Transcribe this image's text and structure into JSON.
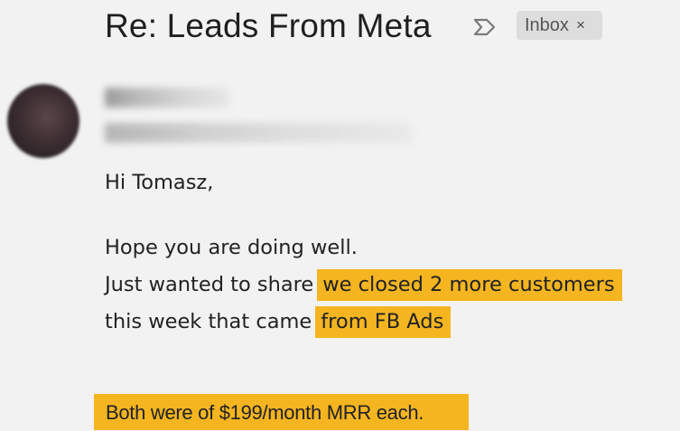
{
  "email": {
    "subject": "Re: Leads From Meta",
    "label_chip": {
      "text": "Inbox",
      "close": "×"
    },
    "greeting": "Hi Tomasz,",
    "line1": "Hope you are doing well.",
    "line2_plain": "Just wanted to share",
    "line2_highlight": "we closed 2 more customers",
    "line3_plain": "this week that came",
    "line3_highlight": "from FB Ads",
    "final_highlight": "Both were of $199/month MRR each."
  },
  "colors": {
    "highlight": "#f4b520",
    "background": "#f2f2f2",
    "chip": "#dddddd"
  },
  "icons": {
    "label": "label-outline-icon",
    "close": "close-icon"
  }
}
